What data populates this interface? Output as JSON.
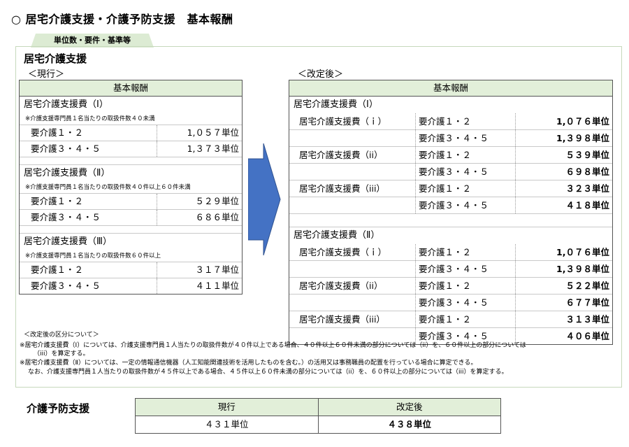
{
  "title": "○ 居宅介護支援・介護予防支援　基本報酬",
  "tag": "単位数・要件・基準等",
  "section": "居宅介護支援",
  "current_label": "＜現行＞",
  "revised_label": "＜改定後＞",
  "left_header": "基本報酬",
  "right_header": "基本報酬",
  "current": {
    "g1": {
      "name": "居宅介護支援費（Ⅰ）",
      "note": "※介護支援専門員１名当たりの取扱件数４０未満",
      "r1_label": "要介護１・２",
      "r1_value": "1,０５７単位",
      "r2_label": "要介護３・４・５",
      "r2_value": "1,３７３単位"
    },
    "g2": {
      "name": "居宅介護支援費（Ⅱ）",
      "note": "※介護支援専門員１名当たりの取扱件数４０件以上６０件未満",
      "r1_label": "要介護１・２",
      "r1_value": "５２９単位",
      "r2_label": "要介護３・４・５",
      "r2_value": "６８６単位"
    },
    "g3": {
      "name": "居宅介護支援費（Ⅲ）",
      "note": "※介護支援専門員１名当たりの取扱件数６０件以上",
      "r1_label": "要介護１・２",
      "r1_value": "３１７単位",
      "r2_label": "要介護３・４・５",
      "r2_value": "４１１単位"
    }
  },
  "revised": {
    "I": {
      "name": "居宅介護支援費（Ⅰ）",
      "i": {
        "name": "居宅介護支援費（ｉ）",
        "r1": "要介護１・２",
        "v1": "1,０７６単位",
        "r2": "要介護３・４・５",
        "v2": "1,３９８単位"
      },
      "ii": {
        "name": "居宅介護支援費（ii）",
        "r1": "要介護１・２",
        "v1": "５３９単位",
        "r2": "要介護３・４・５",
        "v2": "６９８単位"
      },
      "iii": {
        "name": "居宅介護支援費（iii）",
        "r1": "要介護１・２",
        "v1": "３２３単位",
        "r2": "要介護３・４・５",
        "v2": "４１８単位"
      }
    },
    "II": {
      "name": "居宅介護支援費（Ⅱ）",
      "i": {
        "name": "居宅介護支援費（ｉ）",
        "r1": "要介護１・２",
        "v1": "1,０７６単位",
        "r2": "要介護３・４・５",
        "v2": "1,３９８単位"
      },
      "ii": {
        "name": "居宅介護支援費（ii）",
        "r1": "要介護１・２",
        "v1": "５２２単位",
        "r2": "要介護３・４・５",
        "v2": "６７７単位"
      },
      "iii": {
        "name": "居宅介護支援費（iii）",
        "r1": "要介護１・２",
        "v1": "３１３単位",
        "r2": "要介護３・４・５",
        "v2": "４０６単位"
      }
    }
  },
  "notes": {
    "heading": "＜改定後の区分について＞",
    "n1": "※居宅介護支援費（Ⅰ）については、介護支援専門員１人当たりの取扱件数が４０件以上である場合、４０件以上６０件未満の部分については（ii）を、６０件以上の部分については",
    "n1b": "（iii）を算定する。",
    "n2": "※居宅介護支援費（Ⅱ）については、一定の情報通信機器（人工知能関連技術を活用したものを含む。）の活用又は事務職員の配置を行っている場合に算定できる。",
    "n3": "なお、介護支援専門員１人当たりの取扱件数が４５件以上である場合、４５件以上６０件未満の部分については（ii）を、６０件以上の部分については（iii）を算定する。"
  },
  "prevention": {
    "title": "介護予防支援",
    "col_current": "現行",
    "col_revised": "改定後",
    "val_current": "４３１単位",
    "val_revised": "４３８単位"
  },
  "colors": {
    "header_bg": "#e2efd9",
    "arrow": "#4472c4"
  }
}
